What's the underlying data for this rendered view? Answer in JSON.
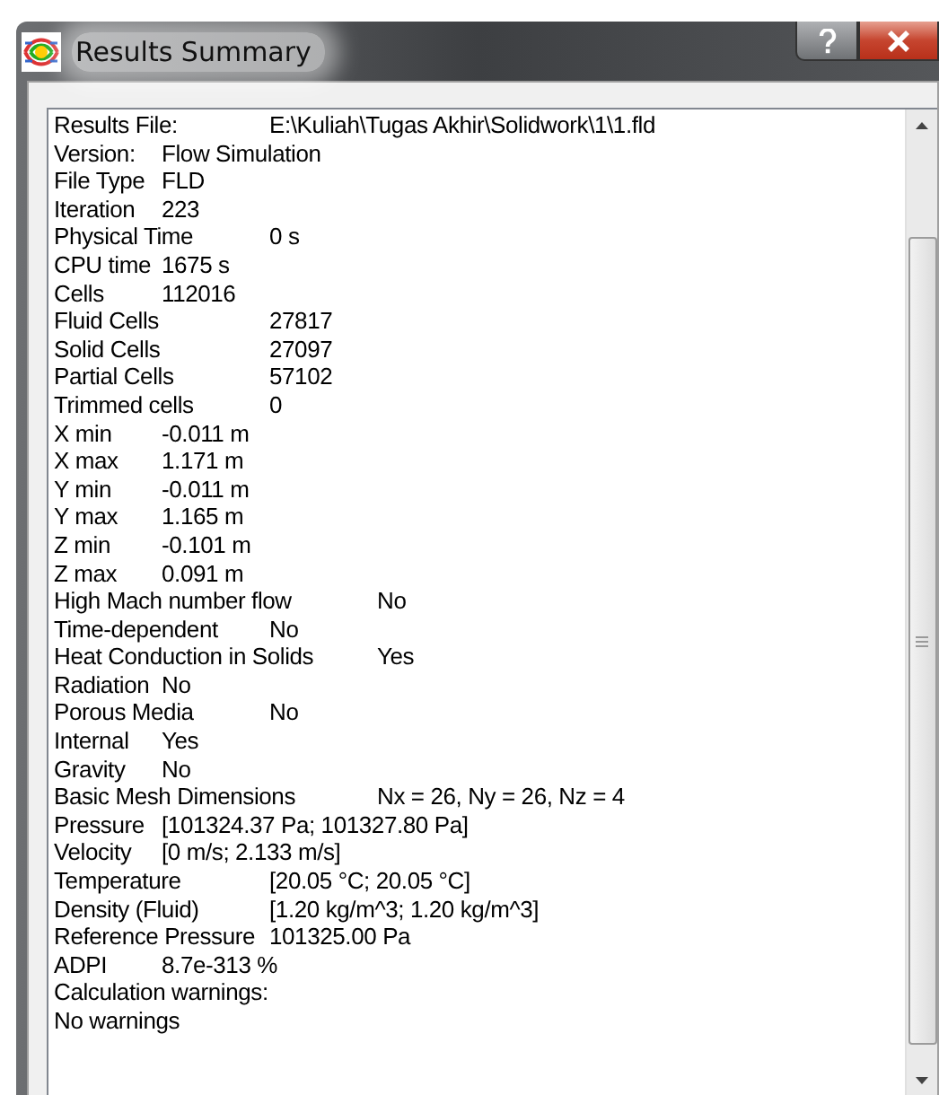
{
  "window": {
    "title": "Results Summary"
  },
  "lines": [
    {
      "label": "Results File:",
      "value": "E:\\Kuliah\\Tugas Akhir\\Solidwork\\1\\1.fld"
    },
    {
      "label": "Version:",
      "value": "Flow Simulation"
    },
    {
      "label": "File Type",
      "value": "FLD"
    },
    {
      "label": "Iteration",
      "value": "223"
    },
    {
      "label": "Physical Time",
      "value": "0 s"
    },
    {
      "label": "CPU time",
      "value": "1675 s"
    },
    {
      "label": "Cells",
      "value": "112016"
    },
    {
      "label": "Fluid Cells",
      "value": "27817"
    },
    {
      "label": "Solid Cells",
      "value": "27097"
    },
    {
      "label": "Partial Cells",
      "value": "57102"
    },
    {
      "label": "Trimmed cells",
      "value": "0"
    },
    {
      "label": "X min",
      "value": "-0.011 m"
    },
    {
      "label": "X max",
      "value": "1.171 m"
    },
    {
      "label": "Y min",
      "value": "-0.011 m"
    },
    {
      "label": "Y max",
      "value": "1.165 m"
    },
    {
      "label": "Z min",
      "value": "-0.101 m"
    },
    {
      "label": "Z max",
      "value": "0.091 m"
    },
    {
      "label": "High Mach number flow",
      "value": "No"
    },
    {
      "label": "Time-dependent",
      "value": "No"
    },
    {
      "label": "Heat Conduction in Solids",
      "value": "Yes"
    },
    {
      "label": "Radiation",
      "value": "No"
    },
    {
      "label": "Porous Media",
      "value": "No"
    },
    {
      "label": "Internal",
      "value": "Yes"
    },
    {
      "label": "Gravity",
      "value": "No"
    },
    {
      "label": "Basic Mesh Dimensions",
      "value": "Nx = 26, Ny = 26, Nz = 4"
    },
    {
      "label": "Pressure",
      "value": "[101324.37 Pa; 101327.80 Pa]"
    },
    {
      "label": "Velocity",
      "value": "[0 m/s; 2.133 m/s]"
    },
    {
      "label": "Temperature",
      "value": "[20.05 °C; 20.05 °C]"
    },
    {
      "label": "Density (Fluid)",
      "value": "[1.20 kg/m^3; 1.20 kg/m^3]"
    },
    {
      "label": "Reference Pressure",
      "value": "101325.00 Pa"
    },
    {
      "label": "ADPI",
      "value": "8.7e-313 %"
    },
    {
      "label": "Calculation warnings:"
    },
    {
      "label": "No warnings"
    }
  ]
}
